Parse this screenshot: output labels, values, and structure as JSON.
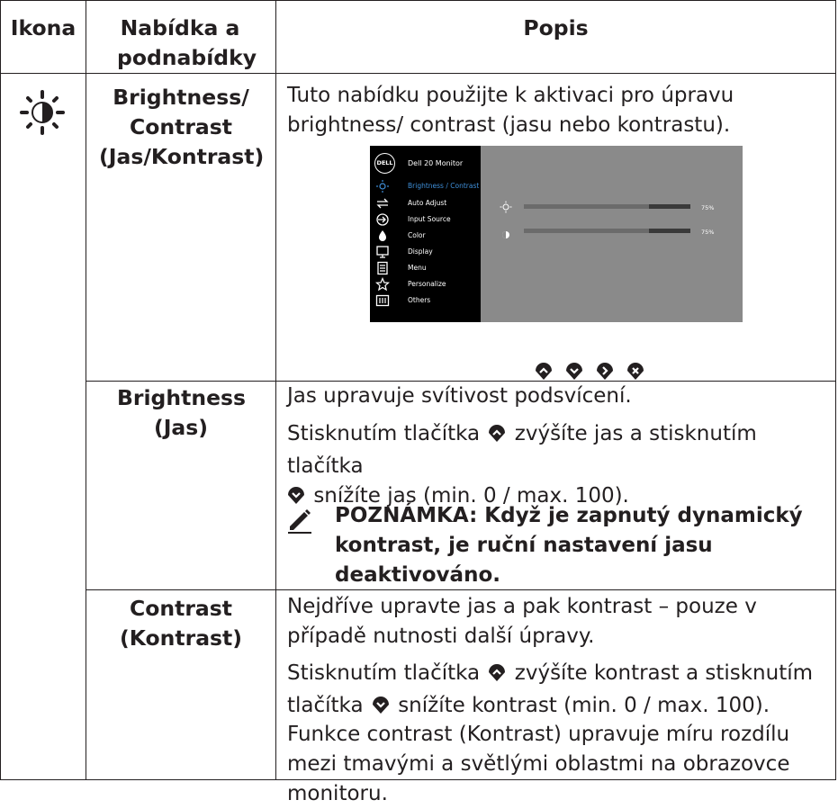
{
  "header": {
    "icon": "Ikona",
    "menu": "Nabídka a podnabídky",
    "desc": "Popis"
  },
  "row1": {
    "icon": "brightness-contrast-icon",
    "submenu": "Brightness/ Contrast (Jas/Kontrast)",
    "desc": "Tuto nabídku použijte k aktivaci pro úpravu brightness/ contrast (jasu nebo kontrastu)."
  },
  "osd": {
    "title": "Dell 20 Monitor",
    "logo": "DELL",
    "items": [
      {
        "label": "Brightness / Contrast",
        "icon": "brightness-icon",
        "selected": true
      },
      {
        "label": "Auto Adjust",
        "icon": "auto-adjust-icon"
      },
      {
        "label": "Input Source",
        "icon": "input-source-icon"
      },
      {
        "label": "Color",
        "icon": "color-icon"
      },
      {
        "label": "Display",
        "icon": "display-icon"
      },
      {
        "label": "Menu",
        "icon": "menu-icon"
      },
      {
        "label": "Personalize",
        "icon": "personalize-icon"
      },
      {
        "label": "Others",
        "icon": "others-icon"
      }
    ],
    "brightness": {
      "value": 0.75,
      "label": "75%"
    },
    "contrast": {
      "value": 0.75,
      "label": "75%"
    },
    "nav_buttons": [
      "up-icon",
      "down-icon",
      "right-icon",
      "close-icon"
    ]
  },
  "row2": {
    "submenu": "Brightness (Jas)",
    "line1": "Jas upravuje svítivost podsvícení.",
    "line2a": "Stisknutím tlačítka",
    "line2b": "zvýšíte jas a stisknutím tlačítka",
    "line2c": "snížíte jas (min. 0 / max. 100).",
    "note": "POZNÁMKA: Když je zapnutý dynamický kontrast, je ruční nastavení jasu deaktivováno."
  },
  "row3": {
    "submenu": "Contrast (Kontrast)",
    "line1": "Nejdříve upravte jas a pak kontrast – pouze v případě nutnosti další úpravy.",
    "line2a": "Stisknutím tlačítka",
    "line2b": "zvýšíte kontrast a stisknutím",
    "line2c": "tlačítka",
    "line2d": "snížíte kontrast (min. 0 / max. 100).",
    "line3": "Funkce contrast (Kontrast) upravuje míru rozdílu mezi tmavými a světlými oblastmi na obrazovce monitoru."
  }
}
